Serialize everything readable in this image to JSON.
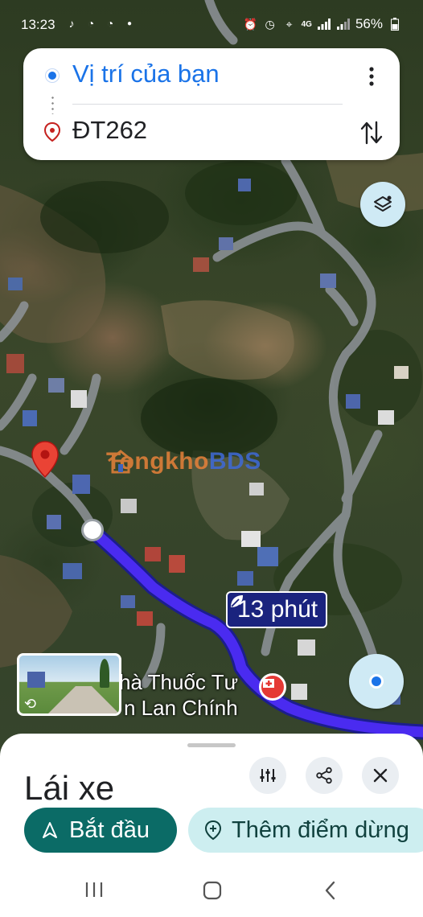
{
  "status_bar": {
    "time": "13:23",
    "network": "4G",
    "battery": "56%"
  },
  "directions": {
    "origin": "Vị trí của bạn",
    "destination": "ĐT262"
  },
  "map": {
    "duration_label": "13 phút",
    "place_name_line1": "hà Thuốc Tư",
    "place_name_line2": "n Lan Chính",
    "watermark_part1": "Tongkho",
    "watermark_part2": "BDS",
    "route_color": "#4a2bf0"
  },
  "sheet": {
    "mode_title": "Lái xe",
    "start_label": "Bắt đầu",
    "add_stop_label": "Thêm điểm dừng"
  },
  "colors": {
    "accent_blue": "#1a73e8",
    "start_button": "#0b6b66",
    "add_stop_button": "#cdeef0",
    "duration_bg": "#1a237e"
  }
}
